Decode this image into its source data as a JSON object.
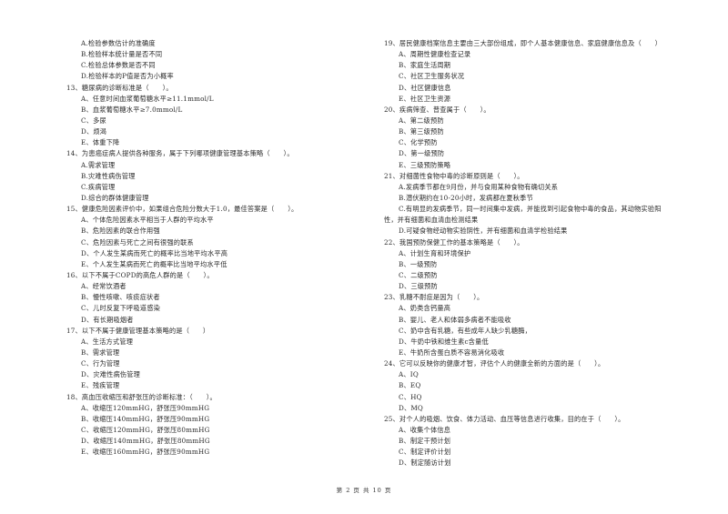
{
  "left_column": [
    {
      "type": "opt",
      "text": "A.检验参数估计的准确度"
    },
    {
      "type": "opt",
      "text": "B.检验样本统计量是否不同"
    },
    {
      "type": "opt",
      "text": "C.检验总体参数是否不同"
    },
    {
      "type": "opt",
      "text": "D.检验样本的P值是否为小概率"
    },
    {
      "type": "q",
      "text": "13、糖尿病的诊断标准是（　　）。"
    },
    {
      "type": "opt",
      "text": "A、任意时间血浆葡萄糖水平≥11.1mmol/L"
    },
    {
      "type": "opt",
      "text": "B、血浆葡萄糖水平≥7.0mmol/L"
    },
    {
      "type": "opt",
      "text": "C、多尿"
    },
    {
      "type": "opt",
      "text": "D、烦渴"
    },
    {
      "type": "opt",
      "text": "E、体重下降"
    },
    {
      "type": "q",
      "text": "14、为患癌症病人提供各种服务，属于下列哪项健康管理基本策略（　　）。"
    },
    {
      "type": "opt",
      "text": "A.需求管理"
    },
    {
      "type": "opt",
      "text": "B.灾难性病伤管理"
    },
    {
      "type": "opt",
      "text": "C.疾病管理"
    },
    {
      "type": "opt",
      "text": "D.综合的群体健康管理"
    },
    {
      "type": "q",
      "text": "15、健康危险因素评价中，如果组合危险分数大于1.0，最佳答案是（　　）。"
    },
    {
      "type": "opt",
      "text": "A、个体危险因素水平相当于人群的平均水平"
    },
    {
      "type": "opt",
      "text": "B、危险因素的联合作用强"
    },
    {
      "type": "opt",
      "text": "C、危险因素与死亡之间有很强的联系"
    },
    {
      "type": "opt",
      "text": "D、个人发生某病而死亡的概率比当地平均水平高"
    },
    {
      "type": "opt",
      "text": "E、个人发生某病而死亡的概率比当地平均水平低"
    },
    {
      "type": "q",
      "text": "16、以下不属于COPD的高危人群的是（　　）。"
    },
    {
      "type": "opt",
      "text": "A、经常饮酒者"
    },
    {
      "type": "opt",
      "text": "B、慢性咳嗽、咳痰症状者"
    },
    {
      "type": "opt",
      "text": "C、儿时反复下呼吸道感染"
    },
    {
      "type": "opt",
      "text": "D、有长期吸烟者"
    },
    {
      "type": "q",
      "text": "17、以下不属于健康管理基本策略的是（　　）"
    },
    {
      "type": "opt",
      "text": "A、生活方式管理"
    },
    {
      "type": "opt",
      "text": "B、需求管理"
    },
    {
      "type": "opt",
      "text": "C、行为管理"
    },
    {
      "type": "opt",
      "text": "D、灾难性病伤管理"
    },
    {
      "type": "opt",
      "text": "E、残疾管理"
    },
    {
      "type": "q",
      "text": "18、高血压收缩压和舒张压的诊断标准：（　　）。"
    },
    {
      "type": "opt",
      "text": "A、收缩压120mmHG，舒张压90mmHG"
    },
    {
      "type": "opt",
      "text": "B、收缩压140mmHG，舒张压90mmHG"
    },
    {
      "type": "opt",
      "text": "C、收缩压120mmHG，舒张压80mmHG"
    },
    {
      "type": "opt",
      "text": "D、收缩压140mmHG，舒张压80mmHG"
    },
    {
      "type": "opt",
      "text": "E、收缩压160mmHG，舒张压90mmHG"
    }
  ],
  "right_column": [
    {
      "type": "q",
      "text": "19、居民健康档案信息主要由三大部份组成，即个人基本健康信息、家庭健康信息及（　　）"
    },
    {
      "type": "opt",
      "text": "A、周期性健康检查记录"
    },
    {
      "type": "opt",
      "text": "B、家庭生活周期"
    },
    {
      "type": "opt",
      "text": "C、社区卫生服务状况"
    },
    {
      "type": "opt",
      "text": "D、社区健康信息"
    },
    {
      "type": "opt",
      "text": "E、社区卫生资源"
    },
    {
      "type": "q",
      "text": "20、疾病筛查、普查属于（　　）。"
    },
    {
      "type": "opt",
      "text": "A、第二级预防"
    },
    {
      "type": "opt",
      "text": "B、第三级预防"
    },
    {
      "type": "opt",
      "text": "C、化学预防"
    },
    {
      "type": "opt",
      "text": "D、第一级预防"
    },
    {
      "type": "opt",
      "text": "E、三级预防策略"
    },
    {
      "type": "q",
      "text": "21、对细菌性食物中毒的诊断原则是（　　）。"
    },
    {
      "type": "opt",
      "text": "A.发病季节都在9月份，并与食用某种食物有确切关系"
    },
    {
      "type": "opt",
      "text": "B.潜伏期约在10-20小时，发病都在夏秋季节"
    },
    {
      "type": "opt",
      "text": "C.有明显的发病季节，同一时间集中发病，并能找到引起食物中毒的食品，其动物实验阳"
    },
    {
      "type": "cont",
      "text": "性，并有细菌和血清血检测结果"
    },
    {
      "type": "opt",
      "text": "D.可疑食物经动物实验阴性，并有细菌和血清学检验结果"
    },
    {
      "type": "q",
      "text": "22、我国预防保健工作的基本策略是（　　）。"
    },
    {
      "type": "opt",
      "text": "A、计划生育和环境保护"
    },
    {
      "type": "opt",
      "text": "B、一级预防"
    },
    {
      "type": "opt",
      "text": "C、二级预防"
    },
    {
      "type": "opt",
      "text": "D、三级预防"
    },
    {
      "type": "q",
      "text": "23、乳糖不耐症是因为（　　）。"
    },
    {
      "type": "opt",
      "text": "A、奶类含钙量高"
    },
    {
      "type": "opt",
      "text": "B、婴儿、老人和体弱多病者不能吸收"
    },
    {
      "type": "opt",
      "text": "C、奶中含有乳糖，有些成年人缺少乳糖酶，"
    },
    {
      "type": "opt",
      "text": "D、牛奶中铁和维生素c含量低"
    },
    {
      "type": "opt",
      "text": "E、牛奶所含蛋白质不容易消化吸收"
    },
    {
      "type": "q",
      "text": "24、它可以反映你的健康才智，评估个人的健康全新的方面的是（　　）。"
    },
    {
      "type": "opt",
      "text": "A、IQ"
    },
    {
      "type": "opt",
      "text": "B、EQ"
    },
    {
      "type": "opt",
      "text": "C、HQ"
    },
    {
      "type": "opt",
      "text": "D、MQ"
    },
    {
      "type": "q",
      "text": "25、对个人的吸烟、饮食、体力活动、血压等信息进行收集，目的在于（　　）。"
    },
    {
      "type": "opt",
      "text": "A、收集个体信息"
    },
    {
      "type": "opt",
      "text": "B、制定干预计划"
    },
    {
      "type": "opt",
      "text": "C、制定评价计划"
    },
    {
      "type": "opt",
      "text": "D、制定随访计划"
    }
  ],
  "footer": {
    "page_label": "第 2 页 共 10 页"
  }
}
